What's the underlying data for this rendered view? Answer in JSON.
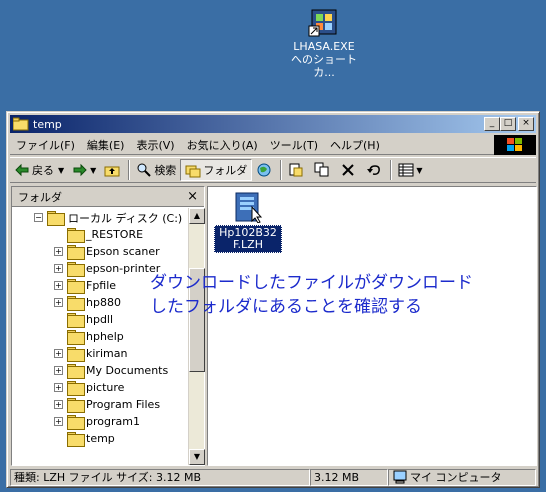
{
  "desktop": {
    "shortcut_line1": "LHASA.EXE",
    "shortcut_line2": "へのショートカ..."
  },
  "window": {
    "title": "temp",
    "buttons": {
      "minimize": "_",
      "maximize": "□",
      "close": "×"
    }
  },
  "menubar": [
    "ファイル(F)",
    "編集(E)",
    "表示(V)",
    "お気に入り(A)",
    "ツール(T)",
    "ヘルプ(H)"
  ],
  "toolbar": {
    "back": "戻る",
    "search": "検索",
    "folders": "フォルダ"
  },
  "folder_pane": {
    "title": "フォルダ",
    "close": "×",
    "drive": "ローカル ディスク (C:)",
    "items": [
      {
        "label": "_RESTORE",
        "expandable": false
      },
      {
        "label": "Epson scaner",
        "expandable": true
      },
      {
        "label": "epson-printer",
        "expandable": true
      },
      {
        "label": "Fpfile",
        "expandable": true
      },
      {
        "label": "hp880",
        "expandable": true
      },
      {
        "label": "hpdll",
        "expandable": false
      },
      {
        "label": "hphelp",
        "expandable": false
      },
      {
        "label": "kiriman",
        "expandable": true
      },
      {
        "label": "My Documents",
        "expandable": true
      },
      {
        "label": "picture",
        "expandable": true
      },
      {
        "label": "Program Files",
        "expandable": true
      },
      {
        "label": "program1",
        "expandable": true
      },
      {
        "label": "temp",
        "expandable": false
      }
    ]
  },
  "file_list": {
    "file_name": "Hp102B32F.LZH"
  },
  "annotation": {
    "line1": "ダウンロードしたファイルがダウンロード",
    "line2": "したフォルダにあることを確認する"
  },
  "status_bar": {
    "info": "種類: LZH ファイル サイズ: 3.12 MB",
    "size": "3.12 MB",
    "location": "マイ コンピュータ"
  },
  "colors": {
    "desktop": "#3a6ea5",
    "title_active": "#0a246a",
    "annotation": "#1c2bcc"
  }
}
